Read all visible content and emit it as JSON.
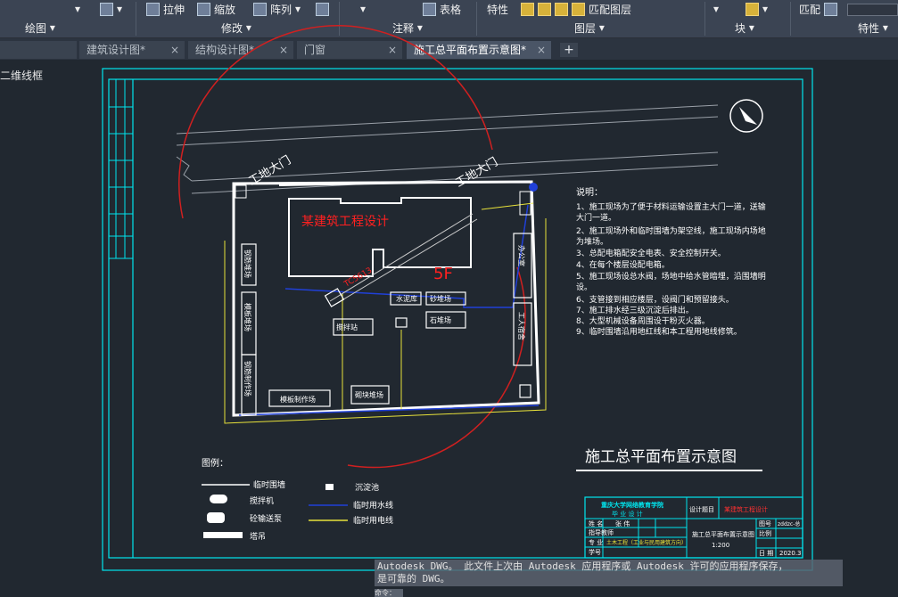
{
  "ribbon": {
    "tools": {
      "stretch": "拉伸",
      "scale": "缩放",
      "array": "阵列",
      "table": "表格",
      "properties": "特性",
      "match_layer": "匹配图层",
      "match": "匹配"
    },
    "panels": {
      "draw": "绘图",
      "modify": "修改",
      "annotate": "注释",
      "layers": "图层",
      "block": "块",
      "properties": "特性"
    }
  },
  "tabs": [
    {
      "label": "建筑设计图*"
    },
    {
      "label": "结构设计图*"
    },
    {
      "label": "门窗"
    },
    {
      "label": "施工总平面布置示意图*"
    }
  ],
  "tab_add": "+",
  "tab_close": "×",
  "viewport": {
    "label": "二维线框"
  },
  "drawing": {
    "gate_left": "工地大门",
    "gate_right": "工地大门",
    "building": "某建筑工程设计",
    "floors": "5F",
    "crane": "TC5613",
    "sites": {
      "cement": "水泥库",
      "sand": "砂堆场",
      "stone": "石堆场",
      "mixer": "搅拌站",
      "rebar_yard": "钢筋堆场",
      "formwork": "模板堆场",
      "rebar_work": "钢筋制作场",
      "form_work": "模板制作场",
      "brick": "砌块堆场",
      "office": "办公室",
      "dorm": "工人宿舍"
    },
    "notes_title": "说明：",
    "notes": [
      "1、施工现场为了便于材料运输设置主大门一道，送输",
      "   大门一道。",
      "2、施工现场外和临时围墙为架空线，施工现场内场地",
      "   为堆场。",
      "3、总配电箱配安全电表、安全控制开关。",
      "4、在每个楼层设配电箱。",
      "5、施工现场设总水阀，场地中给水管暗埋，沿围墙明",
      "   设。",
      "6、支管接到相应楼层，设阀门和预留接头。",
      "7、施工排水经三级沉淀后排出。",
      "8、大型机械设备周围设干粉灭火器。",
      "9、临时围墙沿用地红线和本工程用地线修筑。"
    ],
    "big_title": "施工总平面布置示意图",
    "legend": {
      "title": "图例：",
      "fence": "临时围墙",
      "mixer": "搅拌机",
      "pump": "砼输送泵",
      "crane": "塔吊",
      "tank": "沉淀池",
      "water": "临时用水线",
      "power": "临时用电线"
    },
    "title_block": {
      "school": "重庆大学网络教育学院",
      "grad": "毕 业 设 计",
      "design_topic": "设计题目",
      "topic": "某建筑工程设计",
      "name": "姓 名",
      "name_val": "张 伟",
      "tutor": "指导教师",
      "major": "专 业",
      "major_val": "土木工程（工业与民用建筑方向）",
      "student_id": "学号",
      "drawing_name": "施工总平面布置示意图",
      "scale": "1:200",
      "drawing_no": "图号",
      "drawing_no_val": "zddzc-总",
      "ratio": "比例",
      "date": "日 期",
      "date_val": "2020.3"
    }
  },
  "command": {
    "line1": "Autodesk DWG。  此文件上次由 Autodesk 应用程序或 Autodesk 许可的应用程序保存，",
    "line2": "是可靠的 DWG。",
    "prompt": "命令："
  }
}
